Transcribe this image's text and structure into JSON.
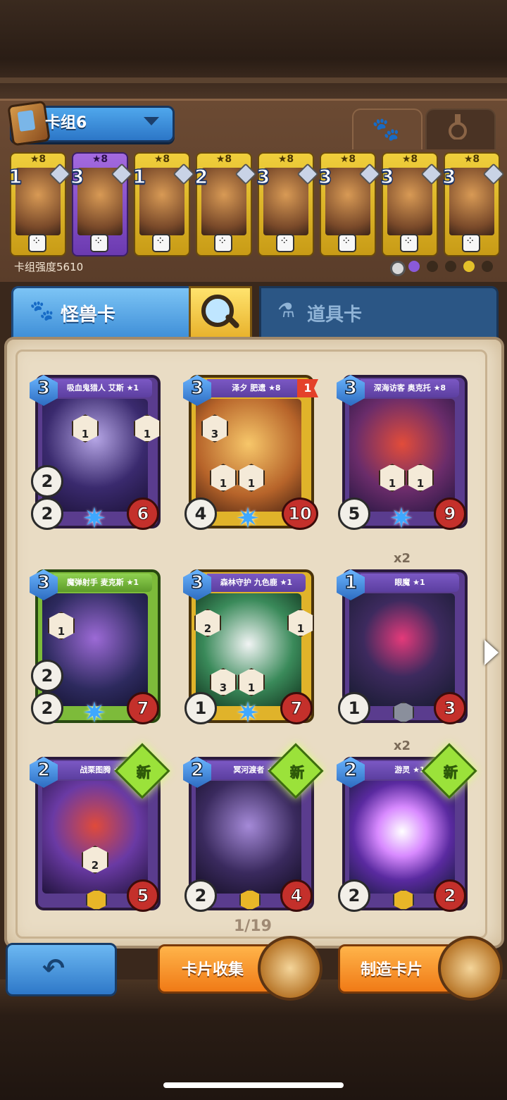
{
  "deck": {
    "name": "卡组6",
    "power_label": "卡组强度5610",
    "cards": [
      {
        "cost": "1",
        "star": "★8",
        "color": "gold"
      },
      {
        "cost": "3",
        "star": "★8",
        "color": "purple"
      },
      {
        "cost": "1",
        "star": "★8",
        "color": "gold"
      },
      {
        "cost": "2",
        "star": "★8",
        "color": "gold"
      },
      {
        "cost": "3",
        "star": "★8",
        "color": "gold"
      },
      {
        "cost": "3",
        "star": "★8",
        "color": "gold"
      },
      {
        "cost": "3",
        "star": "★8",
        "color": "gold"
      },
      {
        "cost": "3",
        "star": "★8",
        "color": "gold"
      }
    ]
  },
  "tabs": {
    "monster_cards": "怪兽卡",
    "item_cards": "道具卡"
  },
  "cards": [
    {
      "name": "吸血鬼猎人 艾斯 ★1",
      "cost": "3",
      "atk": "2",
      "atk2": "2",
      "hp": "6",
      "skills": [
        "1",
        "1"
      ]
    },
    {
      "name": "泽夕 肥遗 ★8",
      "cost": "3",
      "atk": "4",
      "hp": "10",
      "flag": "1",
      "skills": [
        "3",
        "1",
        "1"
      ]
    },
    {
      "name": "深海访客 奥克托 ★8",
      "cost": "3",
      "atk": "5",
      "hp": "9",
      "skills": [
        "1",
        "1"
      ]
    },
    {
      "name": "魔弹射手 麦克斯 ★1",
      "cost": "3",
      "atk": "2",
      "atk2": "2",
      "hp": "7",
      "skills": [
        "1"
      ]
    },
    {
      "name": "森林守护 九色鹿 ★1",
      "cost": "3",
      "atk": "1",
      "hp": "7",
      "skills": [
        "2",
        "3",
        "1",
        "1"
      ]
    },
    {
      "name": "眼魔 ★1",
      "cost": "1",
      "atk": "1",
      "hp": "3",
      "dup": "x2"
    },
    {
      "name": "战栗图腾 ★1",
      "cost": "2",
      "hp": "5",
      "new": "新",
      "skills": [
        "2"
      ]
    },
    {
      "name": "冥河渡者 ★1",
      "cost": "2",
      "atk": "2",
      "hp": "4",
      "new": "新"
    },
    {
      "name": "游灵 ★1",
      "cost": "2",
      "atk": "2",
      "hp": "2",
      "new": "新",
      "dup": "x2"
    }
  ],
  "page_indicator": "1/19",
  "buttons": {
    "collect": "卡片收集",
    "craft": "制造卡片"
  },
  "icons": [
    "book-icon",
    "chevron-down-icon",
    "paw-icon",
    "flask-icon",
    "search-icon",
    "back-arrow-icon",
    "dice-icon",
    "star-icon",
    "gem-icon"
  ],
  "colors": {
    "accent_blue": "#3f8fd8",
    "orange": "#f07a16",
    "parchment": "#e9dcc4"
  }
}
